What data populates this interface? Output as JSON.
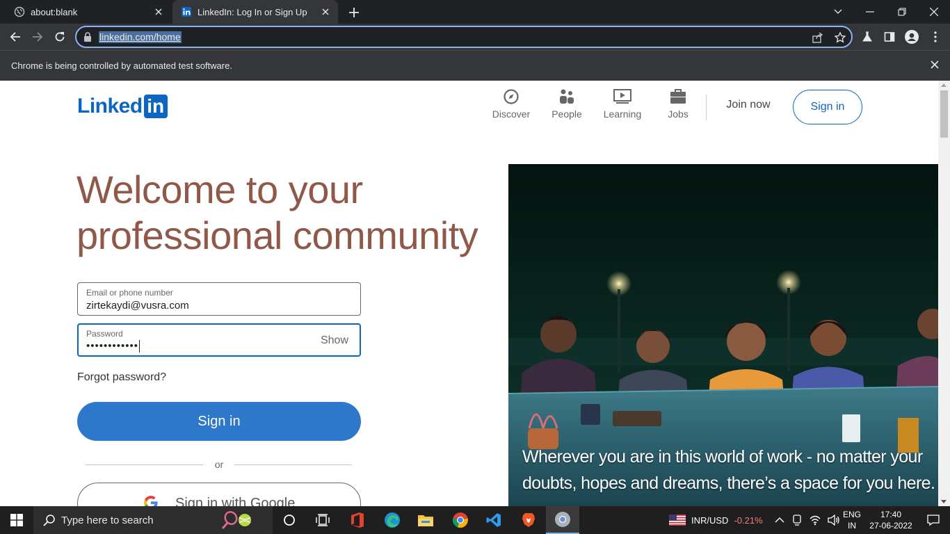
{
  "browser": {
    "tabs": [
      {
        "title": "about:blank",
        "active": false
      },
      {
        "title": "LinkedIn: Log In or Sign Up",
        "active": true
      }
    ],
    "url": "linkedin.com/home",
    "infobar_message": "Chrome is being controlled by automated test software."
  },
  "header": {
    "logo_text": "Linked",
    "logo_badge": "in",
    "nav": [
      {
        "label": "Discover",
        "icon": "compass-icon"
      },
      {
        "label": "People",
        "icon": "people-icon"
      },
      {
        "label": "Learning",
        "icon": "play-board-icon"
      },
      {
        "label": "Jobs",
        "icon": "briefcase-icon"
      }
    ],
    "join_now": "Join now",
    "sign_in": "Sign in"
  },
  "hero": {
    "title_line1": "Welcome to your",
    "title_line2": "professional community",
    "image_caption_line1": "Wherever you are in this world of work - no matter your",
    "image_caption_line2": "doubts, hopes and dreams, there’s a space for you here."
  },
  "form": {
    "email_label": "Email or phone number",
    "email_value": "zirtekaydi@vusra.com",
    "password_label": "Password",
    "password_value": "••••••••••••",
    "show_label": "Show",
    "forgot": "Forgot password?",
    "submit": "Sign in",
    "or": "or",
    "google": "Sign in with Google"
  },
  "taskbar": {
    "search_placeholder": "Type here to search",
    "currency": "INR/USD",
    "currency_change": "-0.21%",
    "lang_line1": "ENG",
    "lang_line2": "IN",
    "time": "17:40",
    "date": "27-06-2022"
  },
  "colors": {
    "linkedin_blue": "#0a66c2",
    "hero_title": "#8f5849",
    "signin_button": "#2e78cb"
  }
}
